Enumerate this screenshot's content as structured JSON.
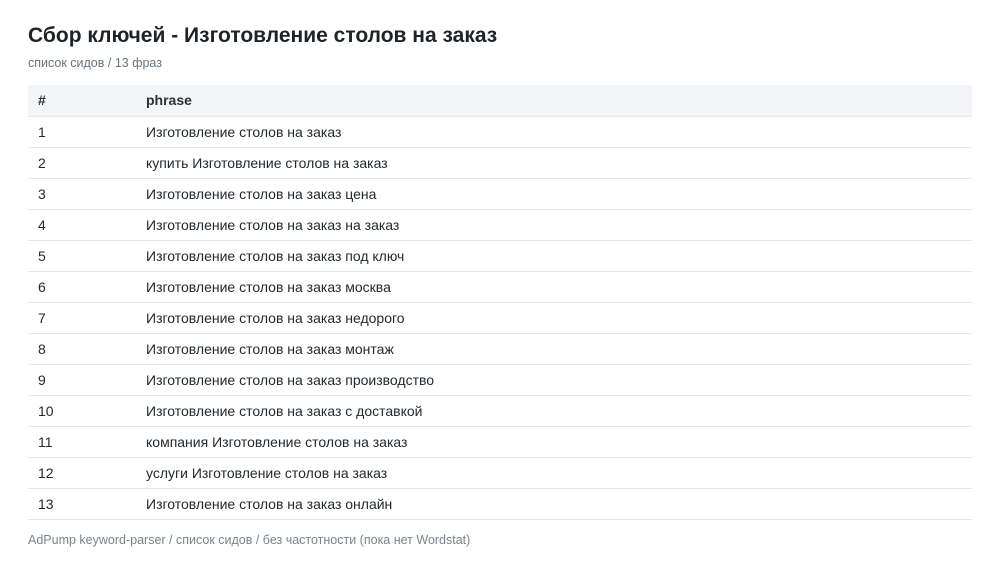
{
  "header": {
    "title": "Сбор ключей - Изготовление столов на заказ",
    "subtitle": "список сидов / 13 фраз"
  },
  "table": {
    "columns": [
      "#",
      "phrase"
    ],
    "rows": [
      {
        "num": "1",
        "phrase": "Изготовление столов на заказ"
      },
      {
        "num": "2",
        "phrase": "купить Изготовление столов на заказ"
      },
      {
        "num": "3",
        "phrase": "Изготовление столов на заказ цена"
      },
      {
        "num": "4",
        "phrase": "Изготовление столов на заказ на заказ"
      },
      {
        "num": "5",
        "phrase": "Изготовление столов на заказ под ключ"
      },
      {
        "num": "6",
        "phrase": "Изготовление столов на заказ москва"
      },
      {
        "num": "7",
        "phrase": "Изготовление столов на заказ недорого"
      },
      {
        "num": "8",
        "phrase": "Изготовление столов на заказ монтаж"
      },
      {
        "num": "9",
        "phrase": "Изготовление столов на заказ производство"
      },
      {
        "num": "10",
        "phrase": "Изготовление столов на заказ с доставкой"
      },
      {
        "num": "11",
        "phrase": "компания Изготовление столов на заказ"
      },
      {
        "num": "12",
        "phrase": "услуги Изготовление столов на заказ"
      },
      {
        "num": "13",
        "phrase": "Изготовление столов на заказ онлайн"
      }
    ]
  },
  "footer": {
    "note": "AdPump keyword-parser / список сидов / без частотности (пока нет Wordstat)"
  },
  "colors": {
    "header_row_bg": "#f3f5f8",
    "row_divider": "#e5e7eb",
    "muted_text": "#6a737d"
  }
}
